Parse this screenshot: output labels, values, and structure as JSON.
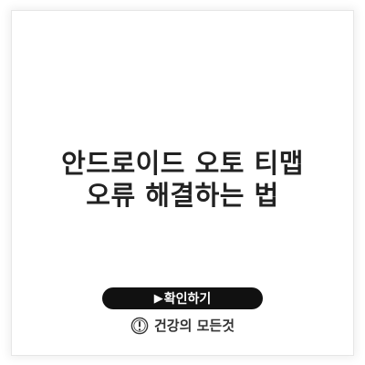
{
  "article": {
    "title_line1": "안드로이드 오토 티맵",
    "title_line2": "오류 해결하는 법"
  },
  "cta": {
    "arrow": "▶",
    "label": "확인하기"
  },
  "brand": {
    "name": "건강의 모든것",
    "logo_icon": "exclamation-circle-icon"
  },
  "colors": {
    "background": "#ffffff",
    "title": "#222222",
    "button_bg": "#111111",
    "button_text": "#ffffff"
  }
}
